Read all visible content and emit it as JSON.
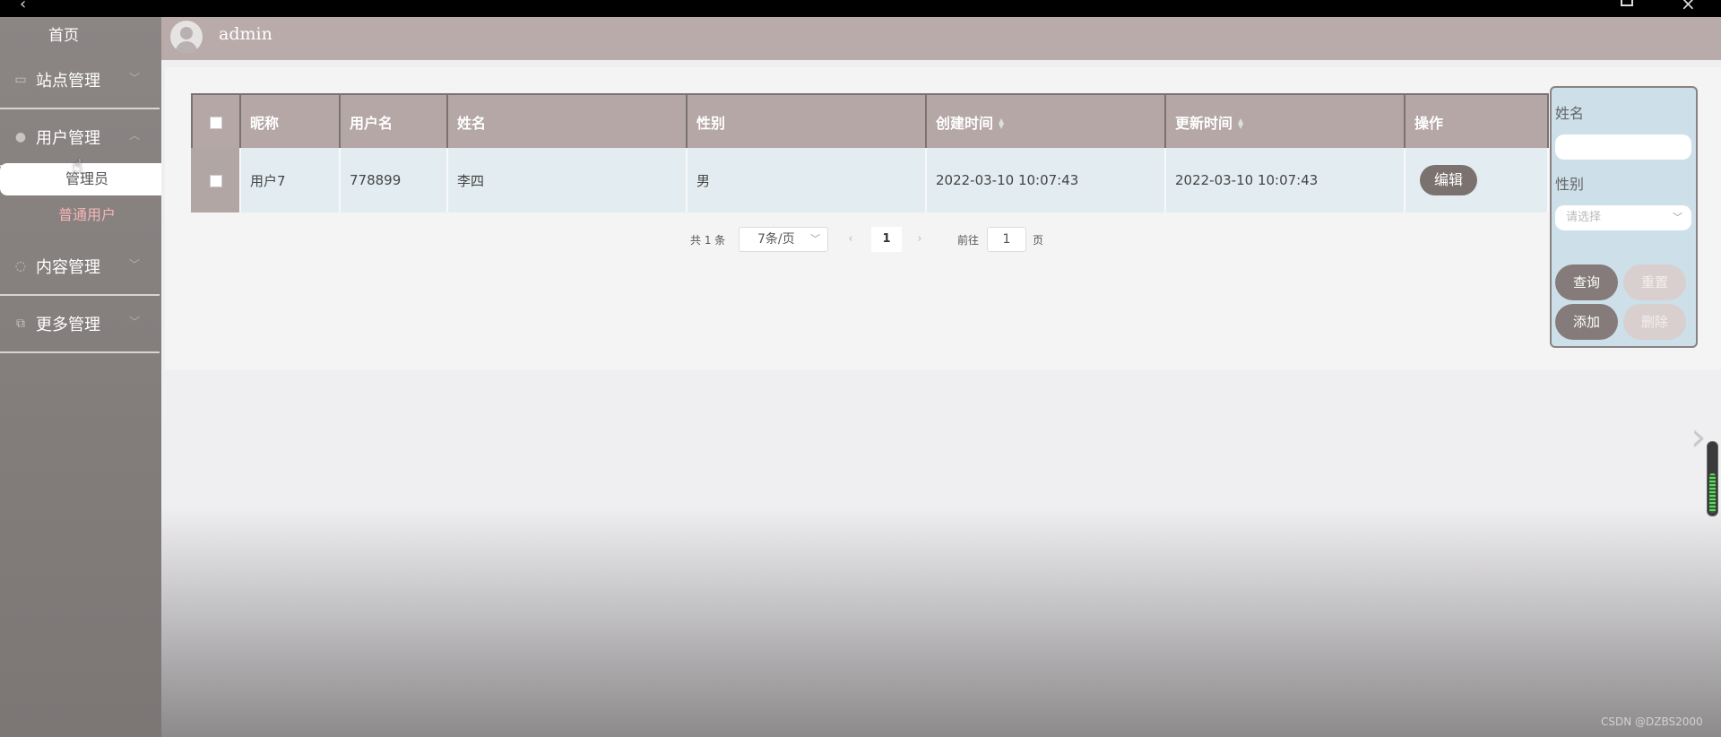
{
  "sidebar": {
    "home": "首页",
    "groups": [
      {
        "label": "站点管理",
        "icon": "monitor-icon"
      },
      {
        "label": "用户管理",
        "icon": "user-icon"
      },
      {
        "label": "内容管理",
        "icon": "message-icon"
      },
      {
        "label": "更多管理",
        "icon": "copy-icon"
      }
    ],
    "user_sub": [
      "管理员",
      "普通用户"
    ]
  },
  "header": {
    "username": "admin"
  },
  "table": {
    "columns": [
      "昵称",
      "用户名",
      "姓名",
      "性别",
      "创建时间",
      "更新时间",
      "操作"
    ],
    "rows": [
      {
        "nickname": "用户7",
        "username": "778899",
        "name": "李四",
        "gender": "男",
        "created": "2022-03-10 10:07:43",
        "updated": "2022-03-10 10:07:43",
        "action": "编辑"
      }
    ]
  },
  "pagination": {
    "total_text": "共 1 条",
    "page_size": "7条/页",
    "current_page": "1",
    "goto_label": "前往",
    "goto_value": "1",
    "page_suffix": "页"
  },
  "filter": {
    "name_label": "姓名",
    "name_value": "",
    "gender_label": "性别",
    "gender_placeholder": "请选择",
    "query": "查询",
    "reset": "重置",
    "add": "添加",
    "delete": "删除"
  },
  "watermark": "CSDN @DZBS2000",
  "colors": {
    "sidebar": "#8b8584",
    "header": "#b9abaa",
    "table_header": "#b4a7a6",
    "row_bg": "#e3edf1",
    "filter_bg": "#cddfe8",
    "button_dark": "#7b7270",
    "active_sub_text": "#f6b6b6"
  }
}
